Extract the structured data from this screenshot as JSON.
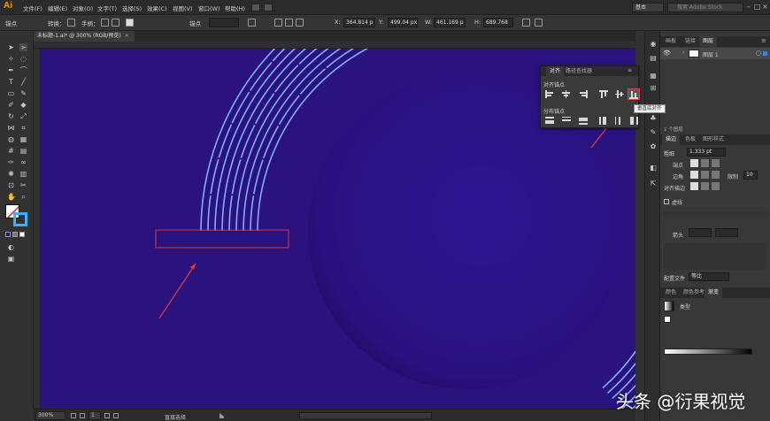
{
  "app": {
    "logo": "Ai"
  },
  "menu": [
    "文件(F)",
    "编辑(E)",
    "对象(O)",
    "文字(T)",
    "选择(S)",
    "效果(C)",
    "视图(V)",
    "窗口(W)",
    "帮助(H)"
  ],
  "workspace": "基本",
  "stock_search_placeholder": "搜索 Adobe Stock",
  "control": {
    "anchor_label": "锚点",
    "convert_label": "转换：",
    "handles_label": "手柄：",
    "anchor_label2": "锚点",
    "x": "364.814 p",
    "y": "499.04 px",
    "w": "461.169 p",
    "h": "689.768"
  },
  "document": {
    "tab_title": "未标题-1.ai* @ 300% (RGB/预览)",
    "close": "×"
  },
  "status": {
    "zoom": "300%",
    "tool_name": "直接选择"
  },
  "align_panel": {
    "tabs": [
      "对齐",
      "路径查找器"
    ],
    "section_anchor": "对齐锚点",
    "section_distribute": "分布锚点",
    "tooltip": "垂直底对齐"
  },
  "layers_panel": {
    "tabs": [
      "画板",
      "链接",
      "图层"
    ],
    "active_tab": "图层",
    "layers": [
      {
        "name": "图层 1"
      }
    ],
    "footer": "1 个图层"
  },
  "stroke_panel": {
    "tabs": [
      "描边",
      "色板",
      "图形样式"
    ],
    "weight_label": "粗细",
    "weight_value": "1.333 pt",
    "cap_label": "端点",
    "corner_label": "边角",
    "limit_label": "限制",
    "limit_value": "10",
    "align_label": "对齐描边",
    "dashed_label": "虚线",
    "arrow_label": "箭头",
    "profile_label": "配置文件",
    "profile_value": "等比"
  },
  "gradient_panel": {
    "tabs": [
      "颜色",
      "颜色参考",
      "渐变"
    ],
    "type_label": "类型"
  },
  "watermark": {
    "text": "头条 @衍果视觉"
  },
  "colors": {
    "canvas": "#2a137f",
    "circle": "#2b1388",
    "stripe": "#7fb0ff",
    "selection": "#e03535",
    "annotation_arrow": "#e23b3b"
  }
}
